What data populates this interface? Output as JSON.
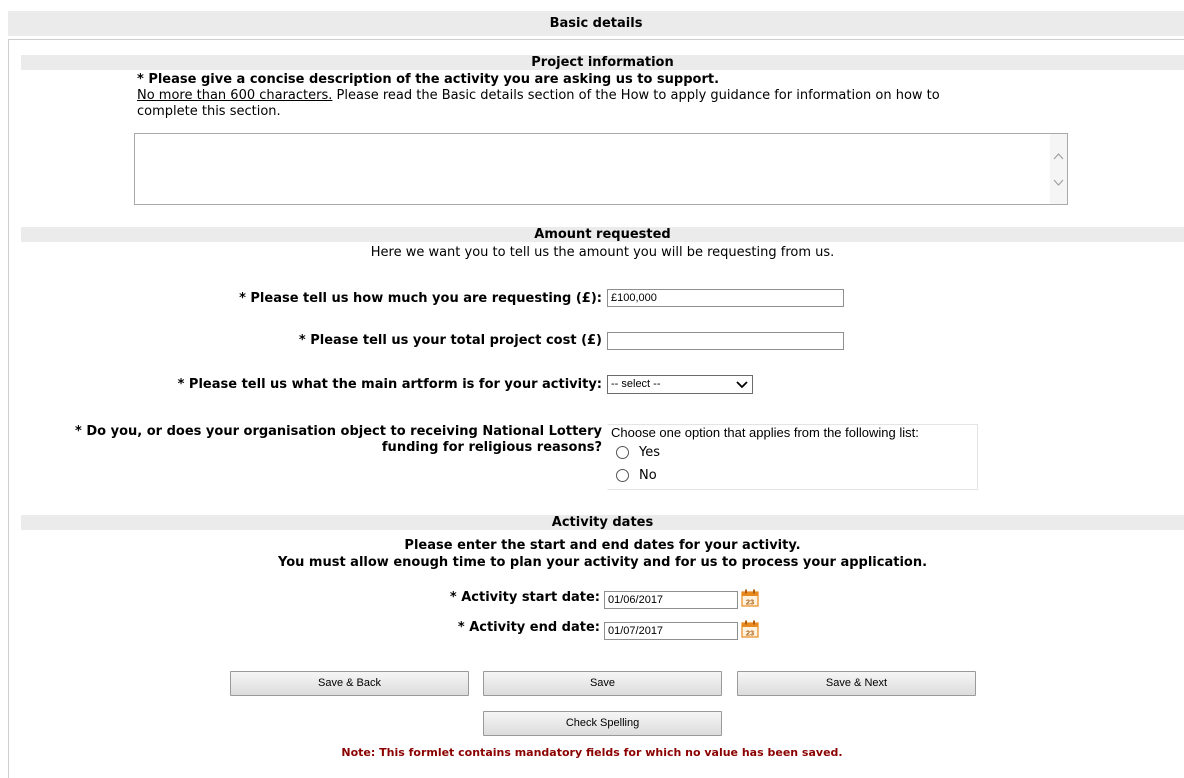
{
  "header": {
    "title": "Basic details"
  },
  "project_info": {
    "band_title": "Project information",
    "question": "* Please give a concise description of the activity you are asking us to support.",
    "limit_text": "No more than 600 characters.",
    "guidance_text": " Please read the Basic details section of the How to apply guidance for information on how to",
    "guidance_text_2": "complete this section.",
    "description_value": ""
  },
  "amount": {
    "band_title": "Amount requested",
    "intro": "Here we want you to tell us the amount you will be requesting from us.",
    "requesting_label": "* Please tell us how much you are requesting (£):",
    "requesting_value": "£100,000",
    "total_cost_label": "* Please tell us your total project cost (£)",
    "total_cost_value": "",
    "artform_label": "* Please tell us what the main artform is for your activity:",
    "artform_selected": "-- select --",
    "religious_label_1": "* Do you, or does your organisation object to receiving National Lottery",
    "religious_label_2": "funding for religious reasons?",
    "religious_prompt": "Choose one option that applies from the following list:",
    "options": [
      "Yes",
      "No"
    ]
  },
  "dates": {
    "band_title": "Activity dates",
    "line1": "Please enter the start and end dates for your activity.",
    "line2": "You must allow enough time to plan your activity and for us to process your application.",
    "start_label": "* Activity start date:",
    "start_value": "01/06/2017",
    "end_label": "* Activity end date:",
    "end_value": "01/07/2017",
    "calendar_day": "23"
  },
  "buttons": {
    "save_back": "Save & Back",
    "save": "Save",
    "save_next": "Save & Next",
    "check_spelling": "Check Spelling"
  },
  "note": "Note: This formlet contains mandatory fields for which no value has been saved.",
  "colors": {
    "band_bg": "#ebebeb",
    "note_color": "#8b0000",
    "calendar_accent": "#e8891d"
  }
}
